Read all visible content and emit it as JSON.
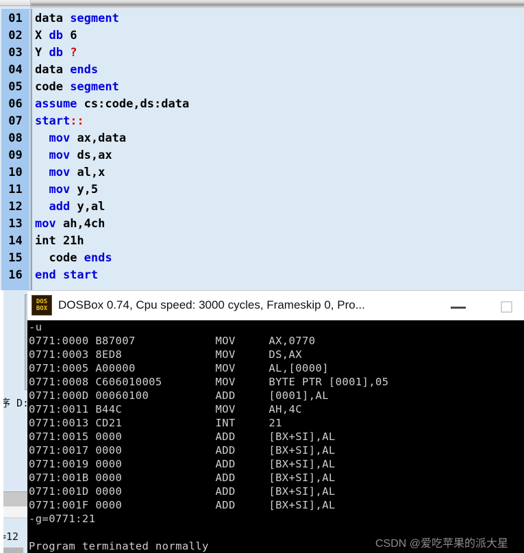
{
  "background_window": {
    "partial_text": "序 D:",
    "status_fragment": "=12"
  },
  "editor": {
    "name": "assembly-source-editor",
    "language": "x86 assembly",
    "line_count": 16,
    "gutter_color": "#a4c8ef",
    "background_color": "#dceaf5",
    "keyword_color": "#0000e0",
    "literal_color": "#e00000",
    "lines": [
      {
        "no": "01",
        "indent": 0,
        "tokens": [
          {
            "t": "data ",
            "c": "plain"
          },
          {
            "t": "segment",
            "c": "kw"
          }
        ]
      },
      {
        "no": "02",
        "indent": 0,
        "tokens": [
          {
            "t": "X ",
            "c": "plain"
          },
          {
            "t": "db",
            "c": "kw"
          },
          {
            "t": " 6",
            "c": "plain"
          }
        ]
      },
      {
        "no": "03",
        "indent": 0,
        "tokens": [
          {
            "t": "Y ",
            "c": "plain"
          },
          {
            "t": "db",
            "c": "kw"
          },
          {
            "t": " ",
            "c": "plain"
          },
          {
            "t": "?",
            "c": "q"
          }
        ]
      },
      {
        "no": "04",
        "indent": 0,
        "tokens": [
          {
            "t": "data ",
            "c": "plain"
          },
          {
            "t": "ends",
            "c": "kw"
          }
        ]
      },
      {
        "no": "05",
        "indent": 0,
        "tokens": [
          {
            "t": "code ",
            "c": "plain"
          },
          {
            "t": "segment",
            "c": "kw"
          }
        ]
      },
      {
        "no": "06",
        "indent": 0,
        "tokens": [
          {
            "t": "assume",
            "c": "kw"
          },
          {
            "t": " cs:code,ds:data",
            "c": "plain"
          }
        ]
      },
      {
        "no": "07",
        "indent": 0,
        "tokens": [
          {
            "t": "start",
            "c": "kw"
          },
          {
            "t": "::",
            "c": "q"
          }
        ]
      },
      {
        "no": "08",
        "indent": 1,
        "tokens": [
          {
            "t": "mov",
            "c": "kw"
          },
          {
            "t": " ax,data",
            "c": "plain"
          }
        ]
      },
      {
        "no": "09",
        "indent": 1,
        "tokens": [
          {
            "t": "mov",
            "c": "kw"
          },
          {
            "t": " ds,ax",
            "c": "plain"
          }
        ]
      },
      {
        "no": "10",
        "indent": 1,
        "tokens": [
          {
            "t": "mov",
            "c": "kw"
          },
          {
            "t": " al,x",
            "c": "plain"
          }
        ]
      },
      {
        "no": "11",
        "indent": 1,
        "tokens": [
          {
            "t": "mov",
            "c": "kw"
          },
          {
            "t": " y,5",
            "c": "plain"
          }
        ]
      },
      {
        "no": "12",
        "indent": 1,
        "tokens": [
          {
            "t": "add",
            "c": "kw"
          },
          {
            "t": " y,al",
            "c": "plain"
          }
        ]
      },
      {
        "no": "13",
        "indent": 0,
        "tokens": [
          {
            "t": "mov",
            "c": "kw"
          },
          {
            "t": " ah,4ch",
            "c": "plain"
          }
        ]
      },
      {
        "no": "14",
        "indent": 0,
        "tokens": [
          {
            "t": "int 21h",
            "c": "plain"
          }
        ]
      },
      {
        "no": "15",
        "indent": 1,
        "tokens": [
          {
            "t": "code ",
            "c": "plain"
          },
          {
            "t": "ends",
            "c": "kw"
          }
        ]
      },
      {
        "no": "16",
        "indent": 0,
        "tokens": [
          {
            "t": "end start",
            "c": "kw"
          }
        ]
      }
    ]
  },
  "dosbox": {
    "icon_label_top": "DOS",
    "icon_label_bottom": "BOX",
    "title": "DOSBox 0.74, Cpu speed:    3000 cycles, Frameskip  0, Pro...",
    "minimize_label": "Minimize",
    "maximize_label": "Maximize",
    "console_lines": [
      "-u",
      "0771:0000 B87007            MOV     AX,0770",
      "0771:0003 8ED8              MOV     DS,AX",
      "0771:0005 A00000            MOV     AL,[0000]",
      "0771:0008 C606010005        MOV     BYTE PTR [0001],05",
      "0771:000D 00060100          ADD     [0001],AL",
      "0771:0011 B44C              MOV     AH,4C",
      "0771:0013 CD21              INT     21",
      "0771:0015 0000              ADD     [BX+SI],AL",
      "0771:0017 0000              ADD     [BX+SI],AL",
      "0771:0019 0000              ADD     [BX+SI],AL",
      "0771:001B 0000              ADD     [BX+SI],AL",
      "0771:001D 0000              ADD     [BX+SI],AL",
      "0771:001F 0000              ADD     [BX+SI],AL",
      "-g=0771:21",
      "",
      "Program terminated normally"
    ],
    "watermark": "CSDN @爱吃苹果的派大星"
  }
}
